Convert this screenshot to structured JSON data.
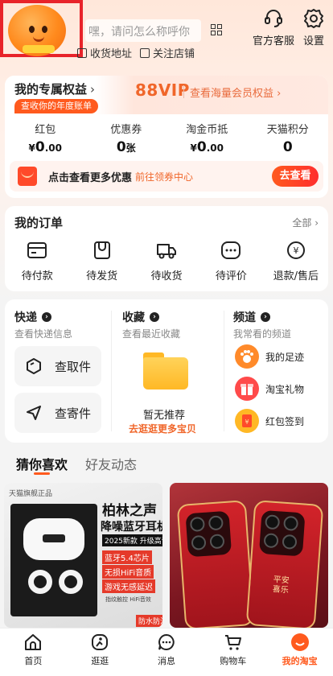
{
  "header": {
    "search_placeholder": "嘿，请问怎么称呼你",
    "links": [
      "收货地址",
      "关注店铺"
    ],
    "actions": [
      {
        "label": "官方客服",
        "icon": "headset-icon"
      },
      {
        "label": "设置",
        "icon": "gear-icon"
      }
    ]
  },
  "rights": {
    "title": "我的专属权益",
    "arrow": "›",
    "year_badge": "查收你的年度账单",
    "vip": "88VIP",
    "vip_text": "查看海量会员权益 ›",
    "stats": [
      {
        "label": "红包",
        "prefix": "¥",
        "value": "0",
        "suffix": ".00"
      },
      {
        "label": "优惠券",
        "prefix": "",
        "value": "0",
        "suffix": "张"
      },
      {
        "label": "淘金币抵",
        "prefix": "¥",
        "value": "0",
        "suffix": ".00"
      },
      {
        "label": "天猫积分",
        "prefix": "",
        "value": "0",
        "suffix": ""
      }
    ],
    "promo_text": "点击查看更多优惠",
    "promo_link": "前往领券中心",
    "promo_button": "去查看"
  },
  "orders": {
    "title": "我的订单",
    "all": "全部 ›",
    "items": [
      {
        "label": "待付款",
        "icon": "wallet-icon"
      },
      {
        "label": "待发货",
        "icon": "package-icon"
      },
      {
        "label": "待收货",
        "icon": "truck-icon"
      },
      {
        "label": "待评价",
        "icon": "comment-icon"
      },
      {
        "label": "退款/售后",
        "icon": "refund-icon"
      }
    ]
  },
  "sections": {
    "express": {
      "title": "快递",
      "sub": "查看快递信息",
      "pickup": "查取件",
      "send": "查寄件"
    },
    "favorites": {
      "title": "收藏",
      "sub": "查看最近收藏",
      "empty_title": "暂无推荐",
      "empty_link": "去逛逛更多宝贝"
    },
    "channels": {
      "title": "频道",
      "sub": "我常看的频道",
      "items": [
        {
          "label": "我的足迹",
          "icon": "paw-icon",
          "color": "#ff8a2a"
        },
        {
          "label": "淘宝礼物",
          "icon": "gift-icon",
          "color": "#ff4a4a"
        },
        {
          "label": "红包签到",
          "icon": "redpacket-icon",
          "color": "#ffb825"
        }
      ]
    }
  },
  "tabs": [
    "猜你喜欢",
    "好友动态"
  ],
  "products": [
    {
      "tag": "天猫旗舰正品",
      "title1": "柏林之声",
      "title2": "降噪蓝牙耳机",
      "title3": "2025新款 升级高音质",
      "features": [
        "蓝牙5.4芯片",
        "无损HiFi音质",
        "游戏无感延迟"
      ],
      "small": "指纹触控      HiFi音效",
      "badge": "防水防汗"
    },
    {
      "text": "平安喜乐"
    }
  ],
  "bottom_nav": [
    {
      "label": "首页",
      "icon": "home-icon"
    },
    {
      "label": "逛逛",
      "icon": "explore-icon"
    },
    {
      "label": "消息",
      "icon": "message-icon"
    },
    {
      "label": "购物车",
      "icon": "cart-icon"
    },
    {
      "label": "我的淘宝",
      "icon": "profile-icon"
    }
  ],
  "colors": {
    "accent": "#ff5a1e",
    "vip": "#f0662a",
    "highlight_box": "#e8232a"
  }
}
